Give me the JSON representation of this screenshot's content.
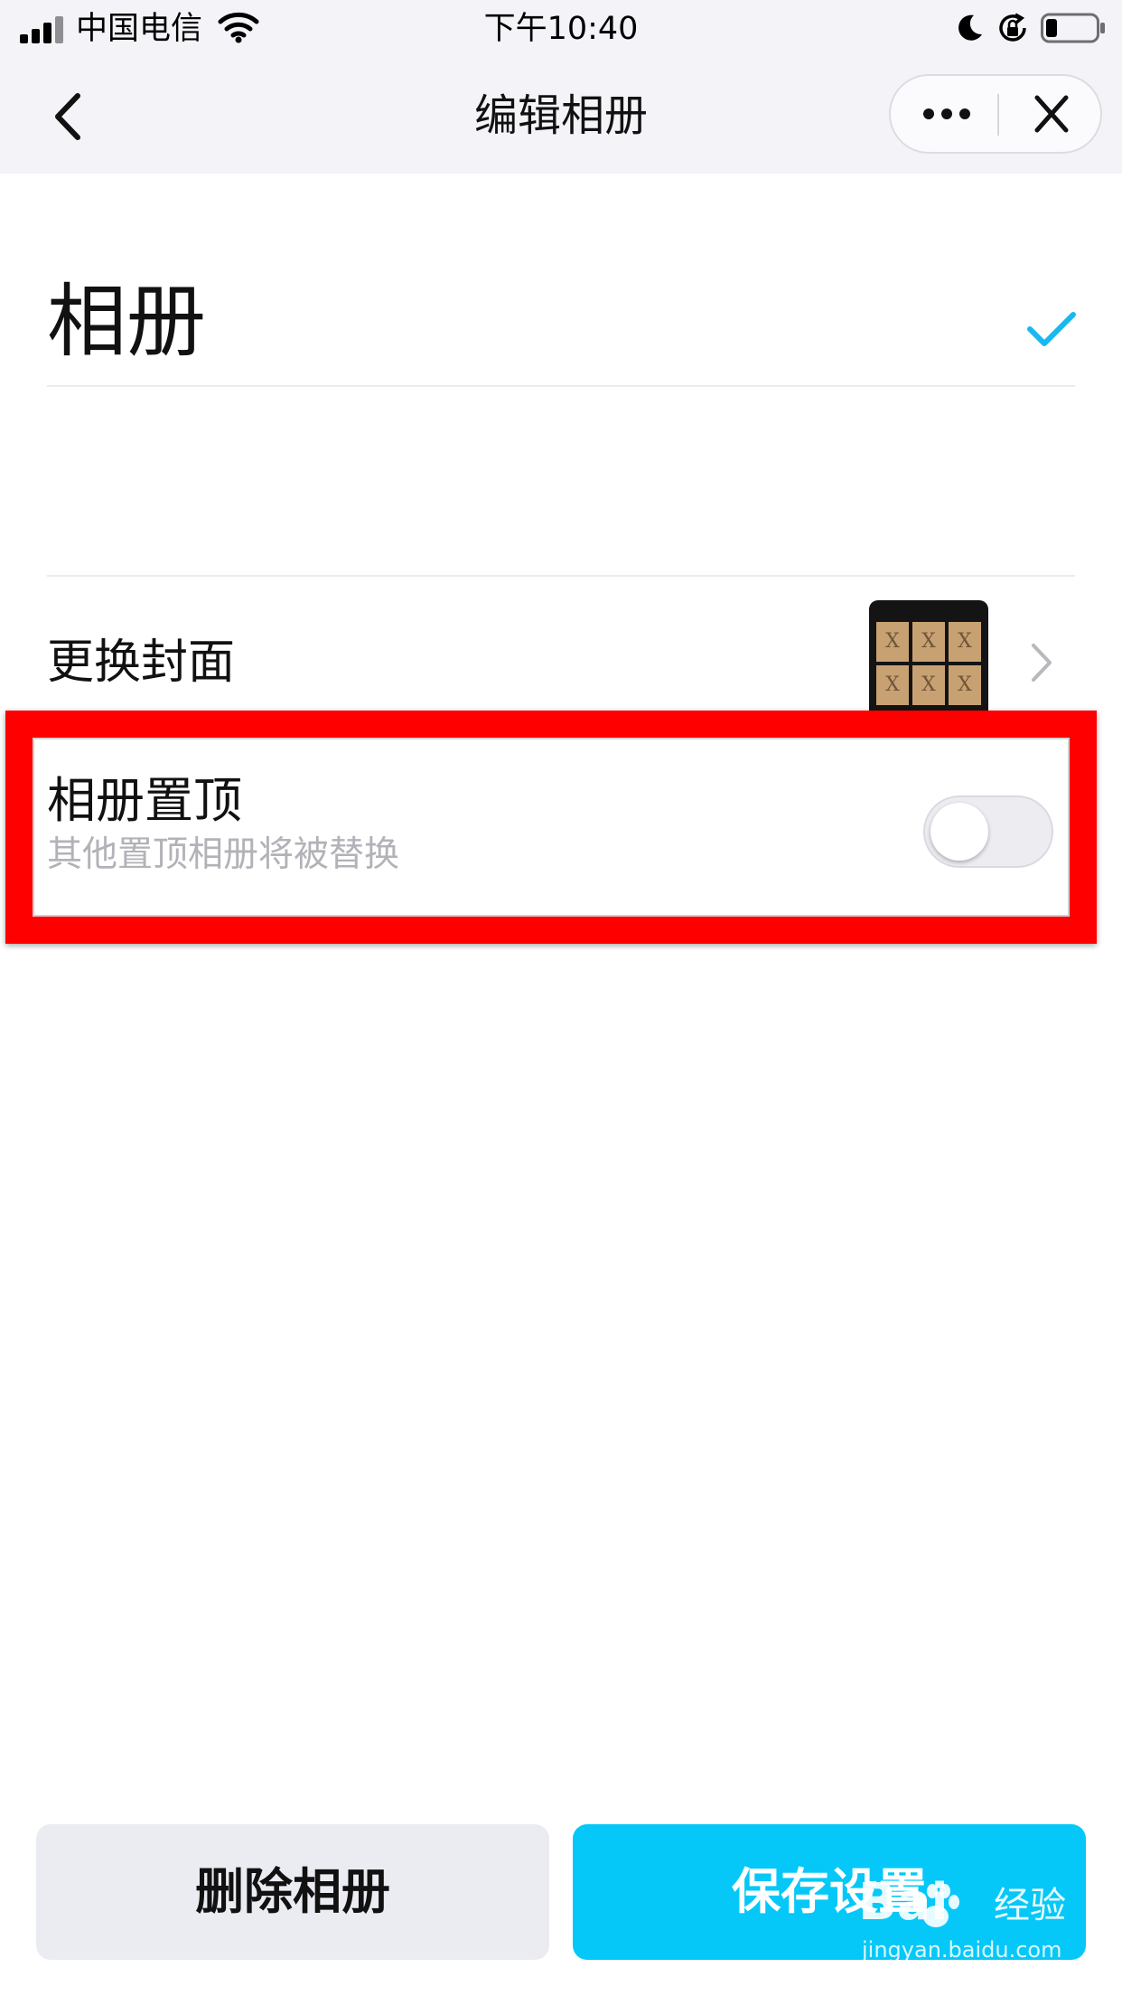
{
  "status_bar": {
    "carrier": "中国电信",
    "time": "下午10:40",
    "icons": [
      "signal-icon",
      "wifi-icon",
      "moon-icon",
      "rotation-lock-icon",
      "battery-icon"
    ]
  },
  "nav": {
    "title": "编辑相册",
    "back_icon": "chevron-left-icon",
    "more_icon": "more-dots-icon",
    "close_icon": "close-icon"
  },
  "album": {
    "name": "相册",
    "selected_icon": "checkmark-icon"
  },
  "cover": {
    "label": "更换封面",
    "thumbnail_tiles": [
      "X",
      "X",
      "X",
      "X",
      "X",
      "X"
    ]
  },
  "pin": {
    "title": "相册置顶",
    "subtitle": "其他置顶相册将被替换",
    "enabled": false
  },
  "actions": {
    "delete_label": "删除相册",
    "save_label": "保存设置"
  },
  "watermark": {
    "logo": "Bai",
    "suffix": "经验",
    "url": "jingyan.baidu.com"
  },
  "colors": {
    "accent": "#05c8f8",
    "highlight": "#ff0000",
    "check": "#1ab8f0",
    "subtitle": "#b2b2b8",
    "secondary_button": "#ebecf1"
  }
}
